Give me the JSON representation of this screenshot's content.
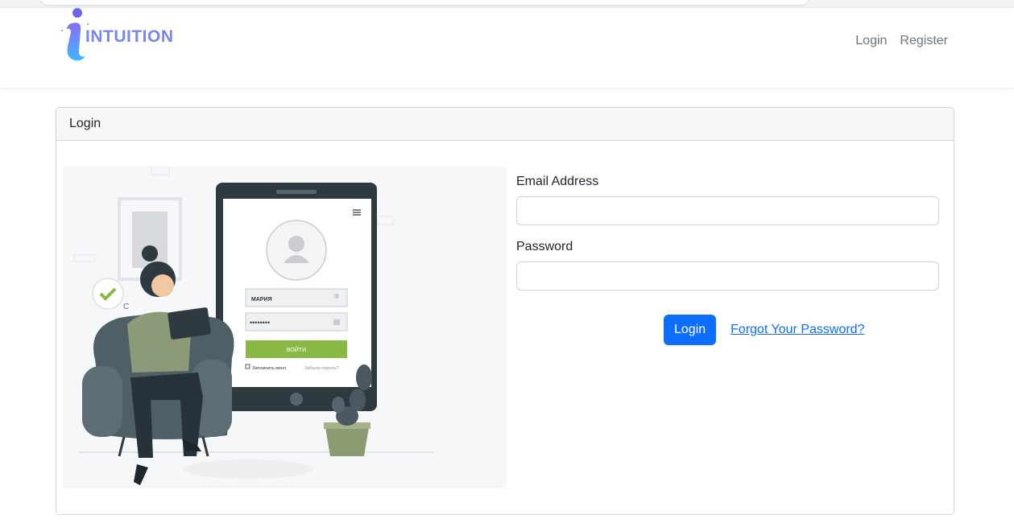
{
  "brand": {
    "name": "INTUITION"
  },
  "nav": {
    "login": "Login",
    "register": "Register"
  },
  "card": {
    "header": "Login"
  },
  "illustration": {
    "username_value": "МАРИЯ",
    "password_mask": "••••••••",
    "submit_label": "ВОЙТИ",
    "remember_label": "Запомнить меня",
    "forgot_label": "Забыли пароль?"
  },
  "form": {
    "email_label": "Email Address",
    "email_value": "",
    "password_label": "Password",
    "password_value": "",
    "submit_label": "Login",
    "forgot_link": "Forgot Your Password?"
  },
  "colors": {
    "primary": "#0d6efd",
    "brand": "#7a86e8",
    "illustration_green": "#87b944"
  }
}
